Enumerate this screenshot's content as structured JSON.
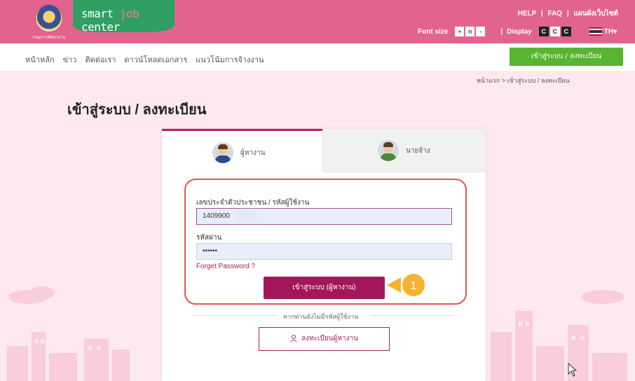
{
  "header": {
    "brand_prefix": "smart ",
    "brand_job": "job",
    "brand_suffix": " center",
    "seal_text": "กรมการจัดหางาน",
    "help": "HELP",
    "faq": "FAQ",
    "sitemap": "แผนผังเว็บไซต์",
    "font_size_label": "Font size",
    "font_buttons": [
      "+",
      "n",
      "-"
    ],
    "display_label": "Display",
    "display_buttons": [
      "C",
      "C",
      "C"
    ],
    "language": "TH",
    "colors": {
      "header_bg": "#e3638f",
      "brand_bg": "#2f9f63"
    }
  },
  "nav": {
    "items": [
      "หน้าหลัก",
      "ข่าว",
      "ติดต่อเรา",
      "ดาวน์โหลดเอกสาร",
      "แนวโน้มการจ้างงาน"
    ],
    "login_register": "เข้าสู่ระบบ / ลงทะเบียน"
  },
  "breadcrumb": {
    "home": "หน้าแรก",
    "sep": ">",
    "current": "เข้าสู่ระบบ / ลงทะเบียน"
  },
  "page_title": "เข้าสู่ระบบ / ลงทะเบียน",
  "tabs": {
    "seeker": "ผู้หางาน",
    "employer": "นายจ้าง"
  },
  "form": {
    "id_label": "เลขประจำตัวประชาชน / รหัสผู้ใช้งาน",
    "id_value": "1409900",
    "password_label": "รหัสผ่าน",
    "password_value": "••••••",
    "forgot": "Forget Password ?",
    "submit": "เข้าสู่ระบบ (ผู้หางาน)",
    "callout_number": "1",
    "no_account": "หากท่านยังไม่มีรหัสผู้ใช้งาน",
    "register": "ลงทะเบียนผู้หางาน"
  }
}
